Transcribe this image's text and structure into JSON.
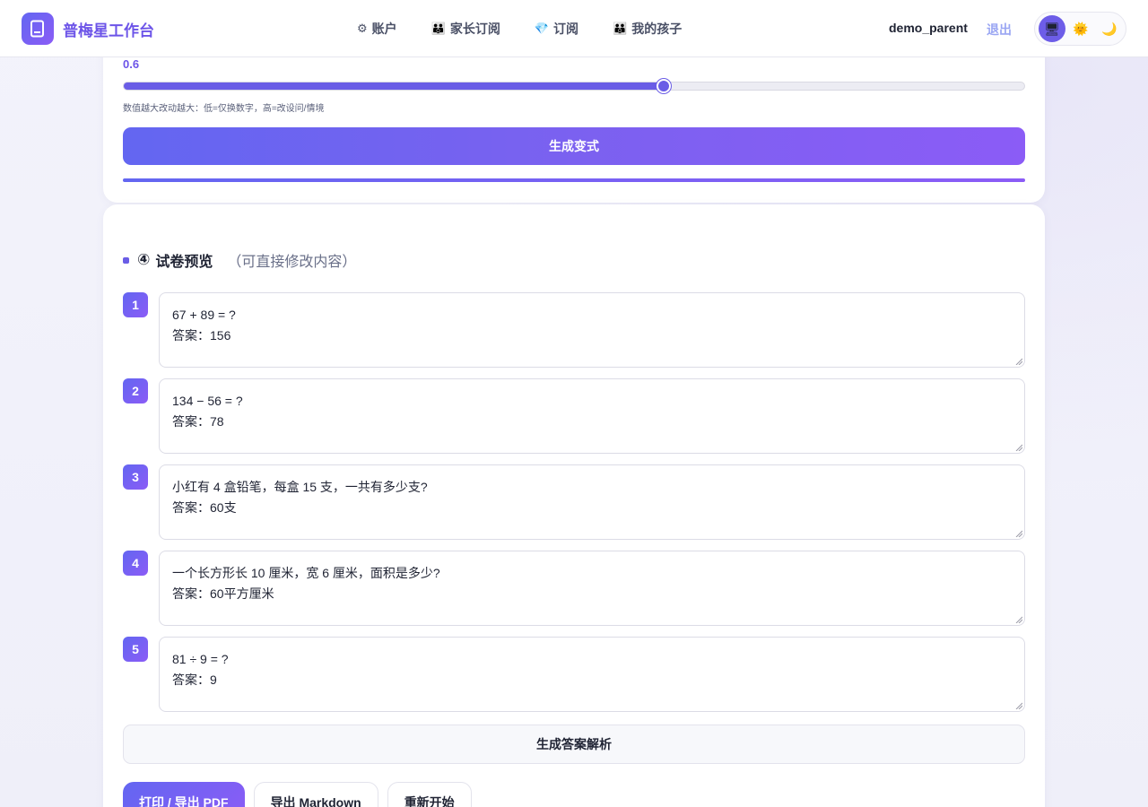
{
  "app": {
    "brand_name": "普梅星工作台",
    "brand_color": "#6c54e8"
  },
  "nav": {
    "items": [
      {
        "label": "账户",
        "icon": "gear-icon",
        "glyph": "⚙"
      },
      {
        "label": "家长订阅",
        "icon": "family-icon",
        "glyph": "👪"
      },
      {
        "label": "订阅",
        "icon": "diamond-icon",
        "glyph": "💎"
      },
      {
        "label": "我的孩子",
        "icon": "family-icon",
        "glyph": "👪"
      }
    ]
  },
  "user": {
    "name": "demo_parent",
    "logout_label": "退出"
  },
  "theme": {
    "options": [
      {
        "name": "system-theme-icon",
        "glyph": "🖥",
        "active": true
      },
      {
        "name": "light-theme-icon",
        "glyph": "🌞",
        "active": false
      },
      {
        "name": "dark-theme-icon",
        "glyph": "🌙",
        "active": false
      }
    ]
  },
  "variation": {
    "slider_value_label": "0.6",
    "slider_value": 0.6,
    "slider_min": 0,
    "slider_max": 1,
    "hint": "数值越大改动越大：低=仅换数字，高=改设问/情境",
    "generate_label": "生成变式",
    "progress": 1.0
  },
  "preview": {
    "number": "④",
    "title": "试卷预览",
    "subtitle": "（可直接修改内容）",
    "questions": [
      {
        "index": "1",
        "text": "67 + 89 = ?\n答案：156"
      },
      {
        "index": "2",
        "text": "134 − 56 = ?\n答案：78"
      },
      {
        "index": "3",
        "text": "小红有 4 盒铅笔，每盒 15 支，一共有多少支?\n答案：60支"
      },
      {
        "index": "4",
        "text": "一个长方形长 10 厘米，宽 6 厘米，面积是多少?\n答案：60平方厘米"
      },
      {
        "index": "5",
        "text": "81 ÷ 9 = ?\n答案：9"
      }
    ],
    "answers_button": "生成答案解析",
    "actions": {
      "print_label": "打印 / 导出 PDF",
      "markdown_label": "导出 Markdown",
      "restart_label": "重新开始"
    }
  },
  "colors": {
    "accent": "#6a5de6",
    "gradient_start": "#6366f1",
    "gradient_end": "#8b5cf6",
    "background": "#f0f0fa"
  }
}
